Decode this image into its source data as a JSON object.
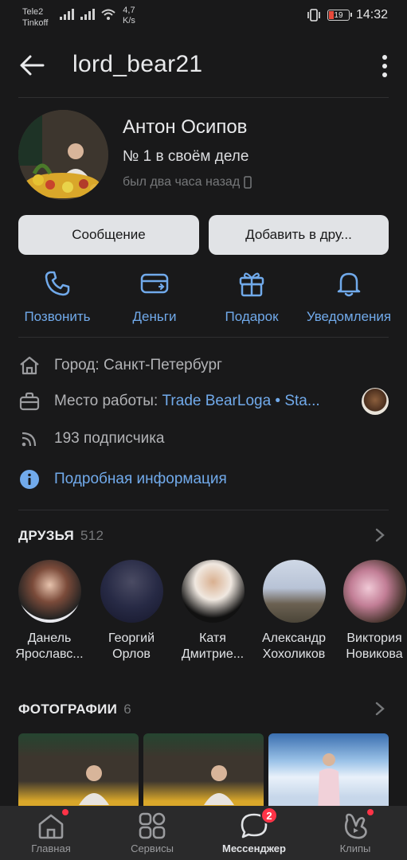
{
  "statusbar": {
    "carrier1": "Tele2",
    "carrier2": "Tinkoff",
    "speed_value": "4,7",
    "speed_unit": "K/s",
    "battery": "19",
    "time": "14:32"
  },
  "header": {
    "username": "lord_bear21"
  },
  "profile": {
    "name": "Антон Осипов",
    "status": "№ 1 в своём деле",
    "last_seen": "был два часа назад"
  },
  "buttons": {
    "message": "Сообщение",
    "add_friend": "Добавить в дру..."
  },
  "actions": [
    {
      "label": "Позвонить",
      "icon": "phone-icon"
    },
    {
      "label": "Деньги",
      "icon": "money-icon"
    },
    {
      "label": "Подарок",
      "icon": "gift-icon"
    },
    {
      "label": "Уведомления",
      "icon": "bell-icon"
    }
  ],
  "info": {
    "city": "Город: Санкт-Петербург",
    "work_prefix": "Место работы: ",
    "work_link": "Trade BearLoga • Sta...",
    "followers": "193 подписчика",
    "details": "Подробная информация"
  },
  "friends": {
    "title": "ДРУЗЬЯ",
    "count": "512",
    "items": [
      {
        "first": "Данель",
        "last": "Ярославс..."
      },
      {
        "first": "Георгий",
        "last": "Орлов"
      },
      {
        "first": "Катя",
        "last": "Дмитрие..."
      },
      {
        "first": "Александр",
        "last": "Хохоликов"
      },
      {
        "first": "Виктория",
        "last": "Новикова"
      }
    ]
  },
  "photos": {
    "title": "ФОТОГРАФИИ",
    "count": "6"
  },
  "tabs": [
    {
      "label": "Главная",
      "icon": "home-icon"
    },
    {
      "label": "Сервисы",
      "icon": "services-icon"
    },
    {
      "label": "Мессенджер",
      "icon": "messenger-icon",
      "badge": "2"
    },
    {
      "label": "Клипы",
      "icon": "clips-icon"
    }
  ],
  "colors": {
    "accent": "#71aaeb",
    "background": "#19191a",
    "badge": "#ff3347"
  }
}
